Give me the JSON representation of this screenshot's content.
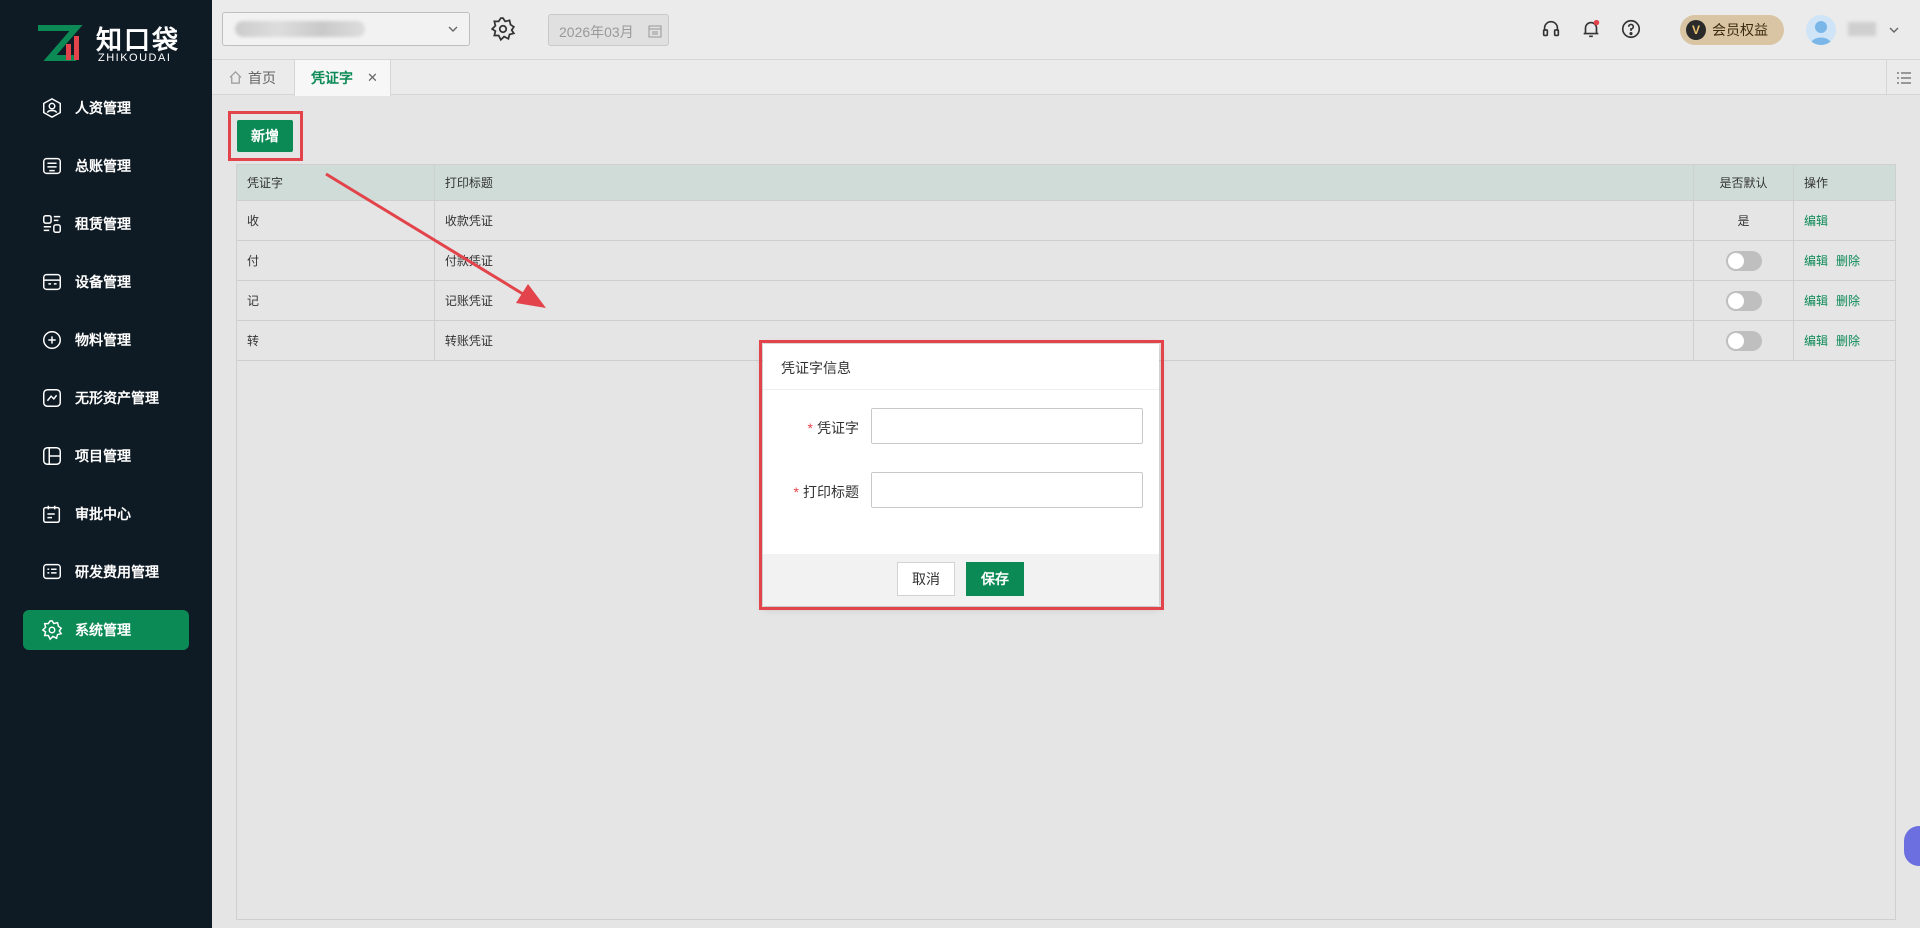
{
  "brand": {
    "cn": "知口袋",
    "en": "ZHIKOUDAI"
  },
  "sidebar": {
    "items": [
      {
        "label": "人资管理",
        "icon": "person-icon"
      },
      {
        "label": "总账管理",
        "icon": "ledger-icon"
      },
      {
        "label": "租赁管理",
        "icon": "lease-icon"
      },
      {
        "label": "设备管理",
        "icon": "device-icon"
      },
      {
        "label": "物料管理",
        "icon": "material-icon"
      },
      {
        "label": "无形资产管理",
        "icon": "intangible-asset-icon"
      },
      {
        "label": "项目管理",
        "icon": "project-icon"
      },
      {
        "label": "审批中心",
        "icon": "approval-icon"
      },
      {
        "label": "研发费用管理",
        "icon": "rd-expense-icon"
      },
      {
        "label": "系统管理",
        "icon": "gear-icon",
        "active": true
      }
    ]
  },
  "header": {
    "period": "2026年03月",
    "member_label": "会员权益",
    "member_badge": "V"
  },
  "tabs": {
    "home": "首页",
    "active": "凭证字",
    "close": "✕"
  },
  "toolbar": {
    "add_label": "新增"
  },
  "table": {
    "columns": [
      "凭证字",
      "打印标题",
      "是否默认",
      "操作"
    ],
    "rows": [
      {
        "word": "收",
        "title": "收款凭证",
        "default_text": "是",
        "is_default": true,
        "actions": [
          "编辑"
        ]
      },
      {
        "word": "付",
        "title": "付款凭证",
        "is_default": false,
        "actions": [
          "编辑",
          "删除"
        ]
      },
      {
        "word": "记",
        "title": "记账凭证",
        "is_default": false,
        "actions": [
          "编辑",
          "删除"
        ]
      },
      {
        "word": "转",
        "title": "转账凭证",
        "is_default": false,
        "actions": [
          "编辑",
          "删除"
        ]
      }
    ]
  },
  "modal": {
    "title": "凭证字信息",
    "required_mark": "*",
    "fields": [
      {
        "label": "凭证字",
        "value": ""
      },
      {
        "label": "打印标题",
        "value": ""
      }
    ],
    "cancel_label": "取消",
    "save_label": "保存"
  },
  "colors": {
    "sidebar_bg": "#0f1b24",
    "accent": "#0b8a55",
    "highlight": "#e3434a",
    "table_header": "#cfdcd7"
  }
}
